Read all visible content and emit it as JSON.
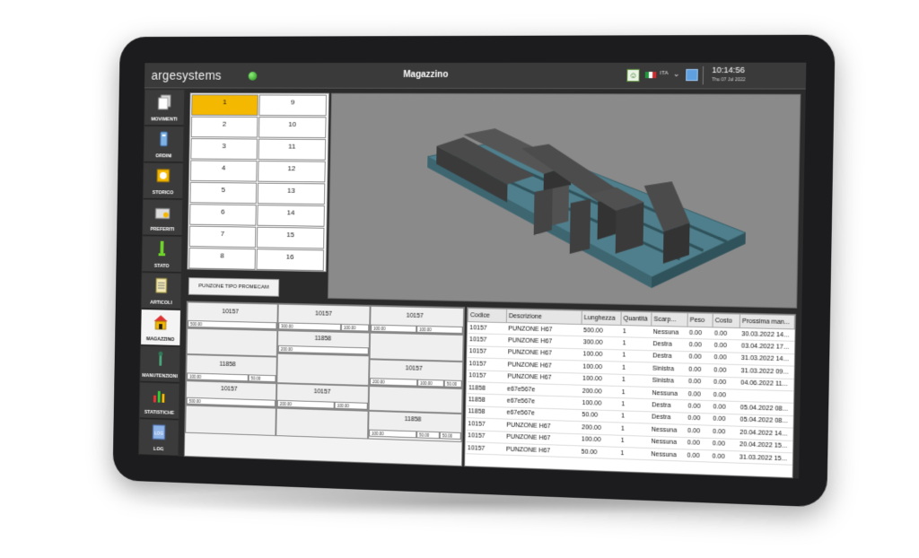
{
  "app": {
    "brand": "argesystems",
    "title": "Magazzino",
    "language": "ITA",
    "time": "10:14:56",
    "date": "Thu 07 Jul 2022"
  },
  "colors": {
    "accent_selected": "#f5b800",
    "status_ok": "#2fbf1f",
    "flag_green": "#1e9a3a",
    "flag_white": "#ffffff",
    "flag_red": "#d22b2b"
  },
  "sidebar": {
    "items": [
      {
        "label": "MOVIMENTI",
        "icon": "document-stack-icon"
      },
      {
        "label": "ORDINI",
        "icon": "clipboard-icon"
      },
      {
        "label": "STORICO",
        "icon": "clock-icon"
      },
      {
        "label": "PREFERITI",
        "icon": "star-folder-icon"
      },
      {
        "label": "STATO",
        "icon": "status-icon"
      },
      {
        "label": "ARTICOLI",
        "icon": "list-icon"
      },
      {
        "label": "MAGAZZINO",
        "icon": "warehouse-icon",
        "active": true
      },
      {
        "label": "MANUTENZIONI",
        "icon": "wrench-icon"
      },
      {
        "label": "STATISTICHE",
        "icon": "chart-icon"
      },
      {
        "label": "LOG",
        "icon": "log-file-icon"
      }
    ]
  },
  "drawers": {
    "left": [
      "1",
      "2",
      "3",
      "4",
      "5",
      "6",
      "7",
      "8"
    ],
    "right": [
      "9",
      "10",
      "11",
      "12",
      "13",
      "14",
      "15",
      "16"
    ],
    "selected": "1"
  },
  "punzone_button": "PUNZONE TIPO PROMECAM",
  "slots": {
    "r1c1": {
      "code": "10157",
      "subs": [
        "500.00"
      ]
    },
    "r1c2": {
      "code": "10157",
      "subs": [
        "300.00",
        "100.00"
      ]
    },
    "r1c3": {
      "code": "10157",
      "subs": [
        "100.00",
        "100.00"
      ]
    },
    "r2c2": {
      "code": "11858",
      "subs": [
        "200.00"
      ]
    },
    "r3c1": {
      "code": "11858",
      "subs": [
        "100.00",
        "50.00"
      ]
    },
    "r3c3": {
      "code": "10157",
      "subs": [
        "200.00",
        "100.00",
        "50.00"
      ]
    },
    "r4c1": {
      "code": "10157",
      "subs": [
        "500.00"
      ]
    },
    "r4c2": {
      "code": "10157",
      "subs": [
        "200.00",
        "100.00"
      ]
    },
    "r5c3": {
      "code": "11858",
      "subs": [
        "100.00",
        "50.00",
        "50.00"
      ]
    }
  },
  "table": {
    "headers": [
      "Codice",
      "Descrizione",
      "Lunghezza",
      "Quantità",
      "Scarp...",
      "Peso",
      "Costo",
      "Prossima man..."
    ],
    "rows": [
      [
        "10157",
        "PUNZONE H67",
        "500.00",
        "1",
        "Nessuna",
        "0.00",
        "0.00",
        "30.03.2022 14..."
      ],
      [
        "10157",
        "PUNZONE H67",
        "300.00",
        "1",
        "Destra",
        "0.00",
        "0.00",
        "03.04.2022 17..."
      ],
      [
        "10157",
        "PUNZONE H67",
        "100.00",
        "1",
        "Destra",
        "0.00",
        "0.00",
        "31.03.2022 14..."
      ],
      [
        "10157",
        "PUNZONE H67",
        "100.00",
        "1",
        "Sinistra",
        "0.00",
        "0.00",
        "31.03.2022 09..."
      ],
      [
        "10157",
        "PUNZONE H67",
        "100.00",
        "1",
        "Sinistra",
        "0.00",
        "0.00",
        "04.06.2022 11..."
      ],
      [
        "11858",
        "e67e567e",
        "200.00",
        "1",
        "Nessuna",
        "0.00",
        "0.00",
        ""
      ],
      [
        "11858",
        "e67e567e",
        "100.00",
        "1",
        "Destra",
        "0.00",
        "0.00",
        "05.04.2022 08..."
      ],
      [
        "11858",
        "e67e567e",
        "50.00",
        "1",
        "Destra",
        "0.00",
        "0.00",
        "05.04.2022 08..."
      ],
      [
        "10157",
        "PUNZONE H67",
        "200.00",
        "1",
        "Nessuna",
        "0.00",
        "0.00",
        "20.04.2022 14..."
      ],
      [
        "10157",
        "PUNZONE H67",
        "100.00",
        "1",
        "Nessuna",
        "0.00",
        "0.00",
        "20.04.2022 15..."
      ],
      [
        "10157",
        "PUNZONE H67",
        "50.00",
        "1",
        "Nessuna",
        "0.00",
        "0.00",
        "31.03.2022 15..."
      ]
    ]
  }
}
